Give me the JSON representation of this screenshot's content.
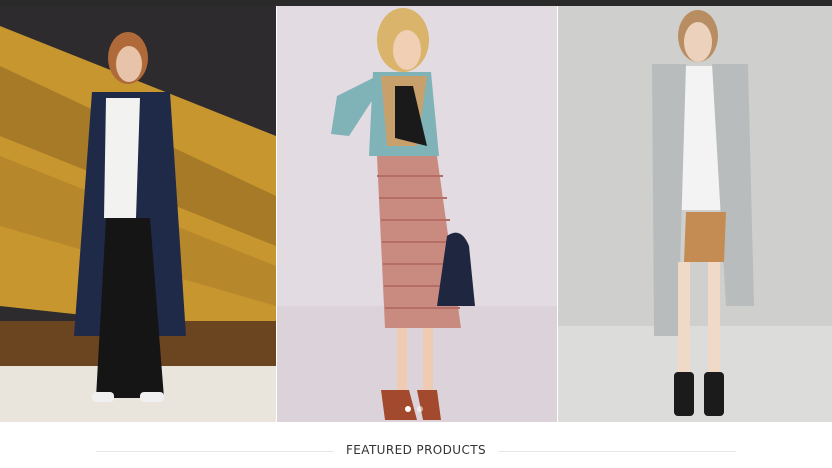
{
  "hero": {
    "slides": [
      {
        "name": "model-navy-coat"
      },
      {
        "name": "model-fringe-skirt"
      },
      {
        "name": "model-grey-scarf"
      }
    ],
    "active_dot": 0,
    "dot_count": 2
  },
  "featured": {
    "title": "FEATURED PRODUCTS"
  },
  "colors": {
    "accent_gold": "#c8962e",
    "navy_coat": "#1f2a48",
    "fringe_pink": "#c98a80",
    "scarf_grey": "#b9bcbd",
    "heading": "#333333"
  }
}
